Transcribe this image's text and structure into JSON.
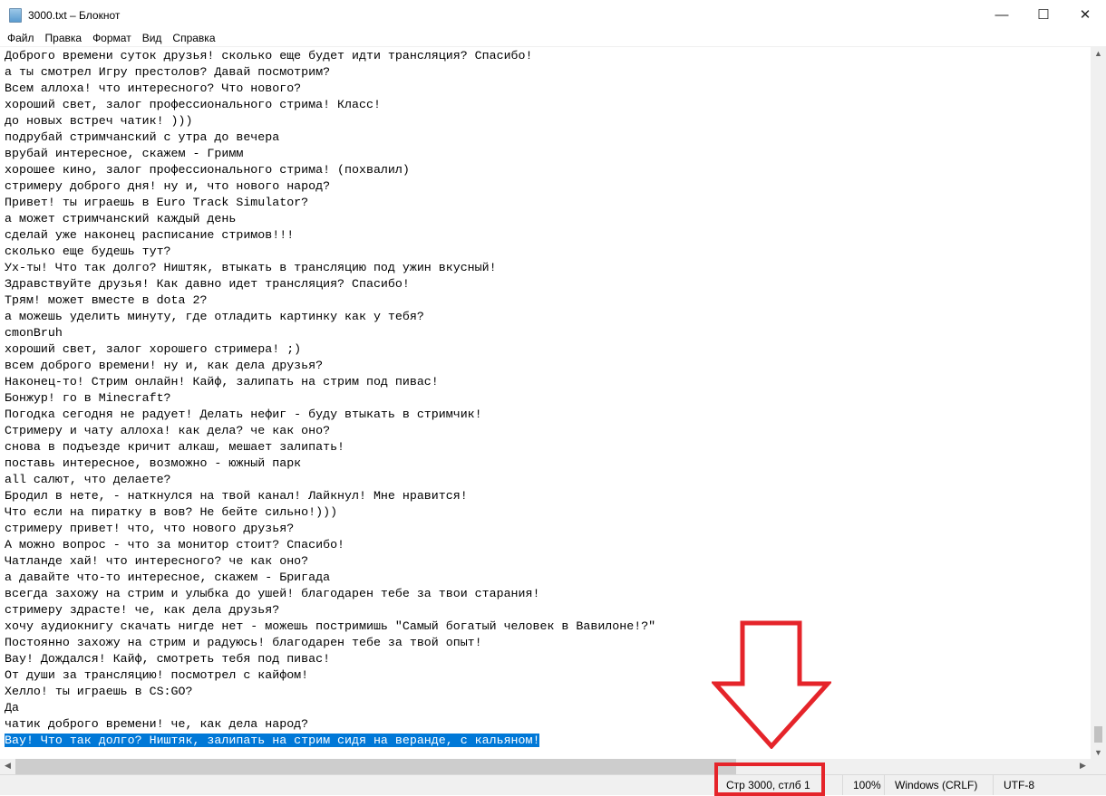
{
  "window": {
    "title": "3000.txt – Блокнот",
    "minimize": "—",
    "maximize": "☐",
    "close": "✕"
  },
  "menu": [
    "Файл",
    "Правка",
    "Формат",
    "Вид",
    "Справка"
  ],
  "lines": [
    "Доброго времени суток друзья! сколько еще будет идти трансляция? Спасибо!",
    "а ты смотрел Игру престолов? Давай посмотрим?",
    "Всем аллоха! что интересного? Что нового?",
    "хороший свет, залог профессионального стрима! Класс!",
    "до новых встреч чатик! )))",
    "подрубай стримчанский с утра до вечера",
    "врубай интересное, скажем - Гримм",
    "хорошее кино, залог профессионального стрима! (похвалил)",
    "стримеру доброго дня! ну и, что нового народ?",
    "Привет! ты играешь в Euro Track Simulator?",
    "а может стримчанский каждый день",
    "сделай уже наконец расписание стримов!!!",
    "сколько еще будешь тут?",
    "Ух-ты! Что так долго? Ништяк, втыкать в трансляцию под ужин вкусный!",
    "Здравствуйте друзья! Как давно идет трансляция? Спасибо!",
    "Трям! может вместе в dota 2?",
    "а можешь уделить минуту, где отладить картинку как у тебя?",
    "cmonBruh",
    "хороший свет, залог хорошего стримера! ;)",
    "всем доброго времени! ну и, как дела друзья?",
    "Наконец-то! Стрим онлайн! Кайф, залипать на стрим под пивас!",
    "Бонжур! го в Minecraft?",
    "Погодка сегодня не радует! Делать нефиг - буду втыкать в стримчик!",
    "Стримеру и чату аллоха! как дела? че как оно?",
    "снова в подъезде кричит алкаш, мешает залипать!",
    "поставь интересное, возможно - южный парк",
    "all салют, что делаете?",
    "Бродил в нете, - наткнулся на твой канал! Лайкнул! Мне нравится!",
    "Что если на пиратку в вов? Не бейте сильно!)))",
    "стримеру привет! что, что нового друзья?",
    "А можно вопрос - что за монитор стоит? Спасибо!",
    "Чатланде хай! что интересного? че как оно?",
    "а давайте что-то интересное, скажем - Бригада",
    "всегда захожу на стрим и улыбка до ушей! благодарен тебе за твои старания!",
    "стримеру здрасте! че, как дела друзья?",
    "хочу аудиокнигу скачать нигде нет - можешь постримишь \"Самый богатый человек в Вавилоне!?\"",
    "Постоянно захожу на стрим и радуюсь! благодарен тебе за твой опыт!",
    "Вау! Дождался! Кайф, смотреть тебя под пивас!",
    "От души за трансляцию! посмотрел с кайфом!",
    "Хелло! ты играешь в CS:GO?",
    "Да",
    "чатик доброго времени! че, как дела народ?",
    "Вау! Что так долго? Ништяк, залипать на стрим сидя на веранде, с кальяном!"
  ],
  "selected_line_index": 42,
  "status": {
    "position": "Стр 3000, стлб 1",
    "zoom": "100%",
    "line_endings": "Windows (CRLF)",
    "encoding": "UTF-8"
  },
  "annotation_color": "#e5242a",
  "selection_color": "#0078d7"
}
